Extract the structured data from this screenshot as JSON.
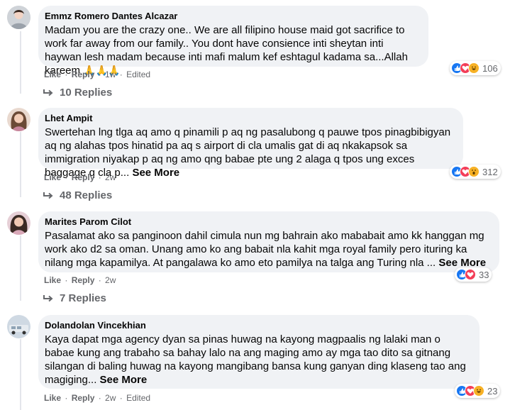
{
  "comments": [
    {
      "author": "Emmz Romero Dantes Alcazar",
      "text": "Madam you are the crazy one.. We are all filipino house maid got sacrifice to work far away from our family.. You dont have consience inti sheytan inti haywan lesh madam because inti mafi malum kef eshtagul kadama sa...Allah kareem",
      "emoji": "🙏🙏🙏",
      "see_more": "",
      "actions": {
        "like": "Like",
        "reply": "Reply",
        "time": "1w",
        "edited": "Edited"
      },
      "reaction_count": "106",
      "replies_label": "10 Replies"
    },
    {
      "author": "Lhet Ampit",
      "text": "Swertehan lng tlga aq amo q pinamili p aq ng pasalubong q pauwe tpos pinagbibigyan aq ng alahas tpos hinatid pa aq s airport di cla umalis gat di aq nkakapsok sa immigration niyakap p aq ng amo qng babae pte ung 2 alaga q tpos ung exces baggage q cla p...",
      "see_more": "See More",
      "actions": {
        "like": "Like",
        "reply": "Reply",
        "time": "2w",
        "edited": ""
      },
      "reaction_count": "312",
      "replies_label": "48 Replies"
    },
    {
      "author": "Marites Parom Cilot",
      "text": "Pasalamat ako sa panginoon dahil cimula nun mg bahrain ako mababait amo kk hanggan mg work ako d2 sa oman. Unang amo ko ang babait nla kahit mga royal family pero ituring ka nilang mga kapamilya. At pangalawa ko amo eto pamilya na talga ang Turing nla ...",
      "see_more": "See More",
      "actions": {
        "like": "Like",
        "reply": "Reply",
        "time": "2w",
        "edited": ""
      },
      "reaction_count": "33",
      "replies_label": "7 Replies"
    },
    {
      "author": "Dolandolan Vincekhian",
      "text": "Kaya dapat mga agency dyan sa pinas huwag na kayong magpaalis ng lalaki man o babae kung ang trabaho sa bahay lalo na ang maging amo ay mga tao dito sa gitnang silangan di baling huwag na kayong mangibang bansa kung ganyan ding klaseng tao ang magiging...",
      "see_more": "See More",
      "actions": {
        "like": "Like",
        "reply": "Reply",
        "time": "2w",
        "edited": "Edited"
      },
      "reaction_count": "23",
      "replies_label": ""
    }
  ],
  "colors": {
    "bubble": "#f0f2f5",
    "secondary_text": "#65676b",
    "like_blue": "#1877f2",
    "love_red": "#f33e58",
    "haha_yellow": "#f7b125"
  },
  "icons": [
    "like-icon",
    "love-icon",
    "haha-icon",
    "wow-icon",
    "reply-arrow-icon",
    "avatar"
  ]
}
